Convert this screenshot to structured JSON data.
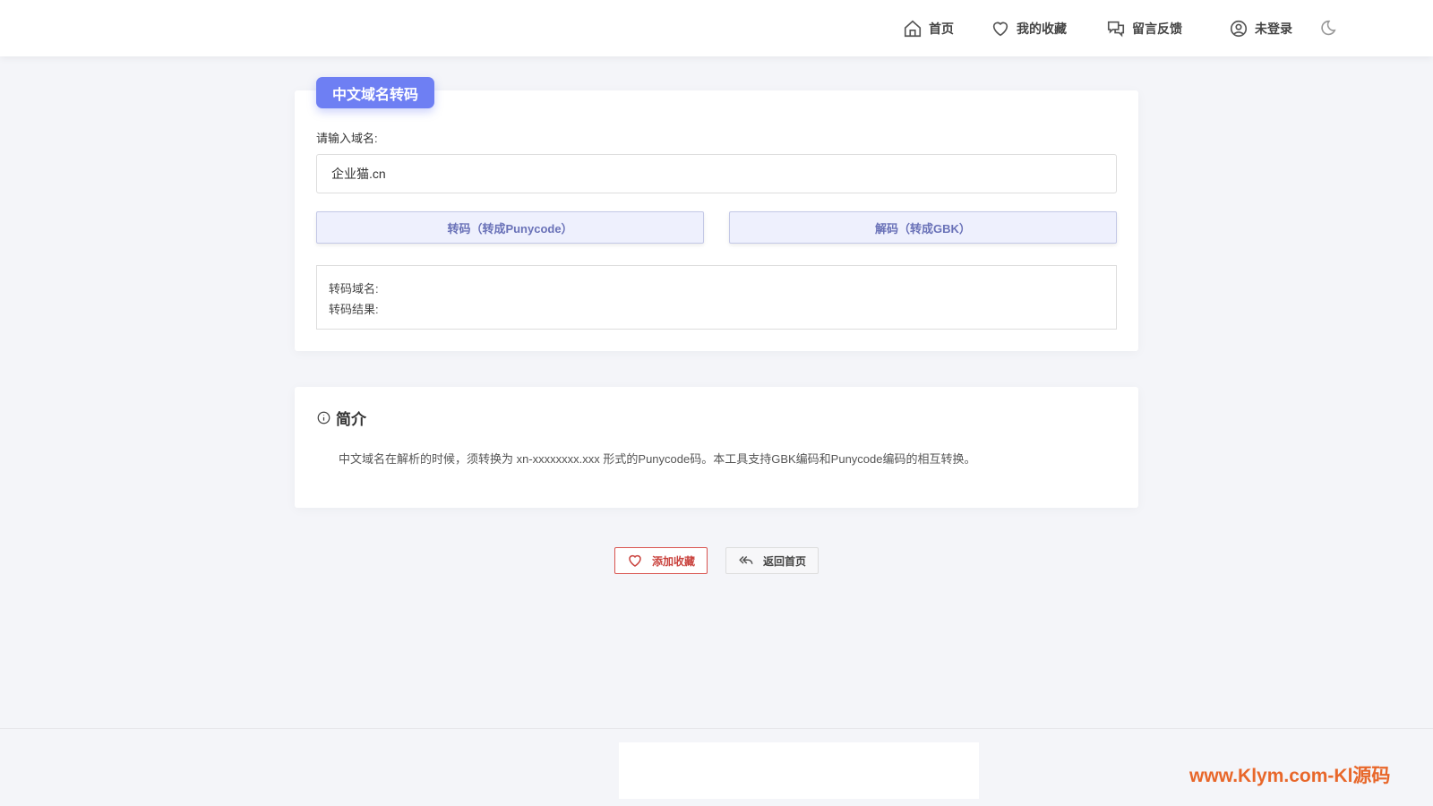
{
  "nav": {
    "home": "首页",
    "favorites": "我的收藏",
    "feedback": "留言反馈",
    "login": "未登录"
  },
  "tool": {
    "title": "中文域名转码",
    "input_label": "请输入域名:",
    "input_value": "企业猫.cn",
    "encode_button": "转码（转成Punycode）",
    "decode_button": "解码（转成GBK）",
    "result_domain_label": "转码域名:",
    "result_label": "转码结果:"
  },
  "intro": {
    "title": "简介",
    "text": "中文域名在解析的时候，须转换为 xn-xxxxxxxx.xxx 形式的Punycode码。本工具支持GBK编码和Punycode编码的相互转换。"
  },
  "actions": {
    "add_favorite": "添加收藏",
    "back_home": "返回首页"
  },
  "watermark": "www.Klym.com-Kl源码"
}
